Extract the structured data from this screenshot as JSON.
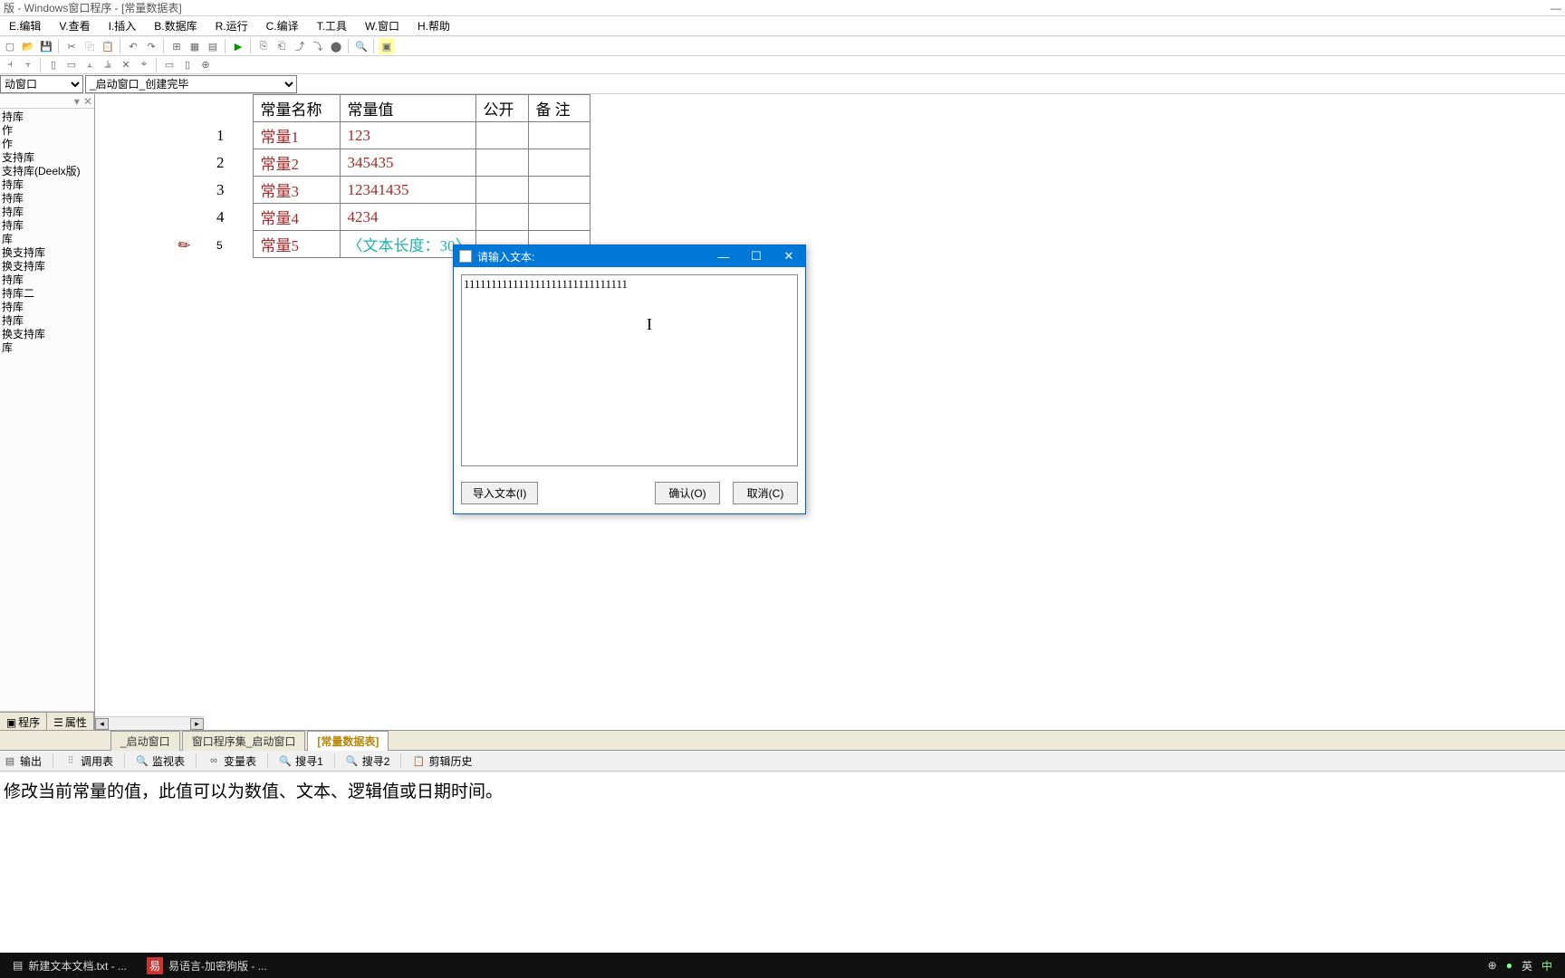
{
  "window": {
    "title": "版 - Windows窗口程序 - [常量数据表]"
  },
  "menu": {
    "edit": "E.编辑",
    "view": "V.查看",
    "insert": "I.插入",
    "database": "B.数据库",
    "run": "R.运行",
    "compile": "C.编译",
    "tools": "T.工具",
    "window": "W.窗口",
    "help": "H.帮助"
  },
  "combos": {
    "combo1": "动窗口",
    "combo2": "_启动窗口_创建完毕"
  },
  "tree": [
    "持库",
    "",
    "",
    "",
    "",
    "",
    "",
    "",
    "",
    "作",
    "",
    "",
    "",
    "",
    "",
    "作",
    "",
    "",
    "",
    "支持库",
    "支持库(Deelx版)",
    "持库",
    "持库",
    "持库",
    "持库",
    "",
    "",
    "库",
    "换支持库",
    "换支持库",
    "持库",
    "持库二",
    "持库",
    "",
    "持库",
    "",
    "换支持库",
    "库"
  ],
  "sidebar_tabs": {
    "program": "程序",
    "props": "属性"
  },
  "grid": {
    "headers": {
      "name": "常量名称",
      "value": "常量值",
      "public": "公开",
      "note": "备 注"
    },
    "rows": [
      {
        "n": "1",
        "name": "常量1",
        "value": "123"
      },
      {
        "n": "2",
        "name": "常量2",
        "value": "345435"
      },
      {
        "n": "3",
        "name": "常量3",
        "value": "12341435"
      },
      {
        "n": "4",
        "name": "常量4",
        "value": "4234"
      },
      {
        "n": "5",
        "name": "常量5",
        "value": "〈文本长度：30〉"
      }
    ]
  },
  "bottom_tabs": {
    "tab1": "_启动窗口",
    "tab2": "窗口程序集_启动窗口",
    "tab3": "[常量数据表]"
  },
  "output_tabs": {
    "out": "输出",
    "call": "调用表",
    "watch": "监视表",
    "var": "变量表",
    "find1": "搜寻1",
    "find2": "搜寻2",
    "clip": "剪辑历史"
  },
  "status_text": "修改当前常量的值，此值可以为数值、文本、逻辑值或日期时间。",
  "dialog": {
    "title": "请输入文本:",
    "text": "111111111111111111111111111111",
    "import": "导入文本(I)",
    "ok": "确认(O)",
    "cancel": "取消(C)"
  },
  "taskbar": {
    "item1": "新建文本文档.txt - ...",
    "item2": "易语言-加密狗版 - ...",
    "ime": "英"
  }
}
